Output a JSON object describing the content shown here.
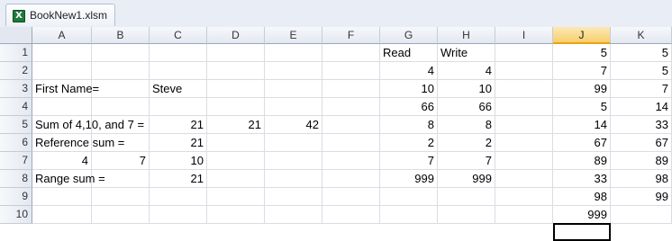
{
  "window": {
    "tab_title": "BookNew1.xlsm",
    "icon": "excel-file-icon"
  },
  "selected_column": "J",
  "columns": [
    "A",
    "B",
    "C",
    "D",
    "E",
    "F",
    "G",
    "H",
    "I",
    "J",
    "K"
  ],
  "rows": [
    "1",
    "2",
    "3",
    "4",
    "5",
    "6",
    "7",
    "8",
    "9",
    "10"
  ],
  "cells": [
    {
      "ref": "G1",
      "value": "Read",
      "type": "txt"
    },
    {
      "ref": "H1",
      "value": "Write",
      "type": "txt"
    },
    {
      "ref": "J1",
      "value": "5",
      "type": "num"
    },
    {
      "ref": "K1",
      "value": "5",
      "type": "num"
    },
    {
      "ref": "G2",
      "value": "4",
      "type": "num"
    },
    {
      "ref": "H2",
      "value": "4",
      "type": "num"
    },
    {
      "ref": "J2",
      "value": "7",
      "type": "num"
    },
    {
      "ref": "K2",
      "value": "5",
      "type": "num"
    },
    {
      "ref": "A3",
      "value": "First Name=",
      "type": "txt"
    },
    {
      "ref": "C3",
      "value": "Steve",
      "type": "txt"
    },
    {
      "ref": "G3",
      "value": "10",
      "type": "num"
    },
    {
      "ref": "H3",
      "value": "10",
      "type": "num"
    },
    {
      "ref": "J3",
      "value": "99",
      "type": "num"
    },
    {
      "ref": "K3",
      "value": "7",
      "type": "num"
    },
    {
      "ref": "G4",
      "value": "66",
      "type": "num"
    },
    {
      "ref": "H4",
      "value": "66",
      "type": "num"
    },
    {
      "ref": "J4",
      "value": "5",
      "type": "num"
    },
    {
      "ref": "K4",
      "value": "14",
      "type": "num"
    },
    {
      "ref": "A5",
      "value": "Sum of 4,10, and 7 =",
      "type": "txt"
    },
    {
      "ref": "C5",
      "value": "21",
      "type": "num"
    },
    {
      "ref": "D5",
      "value": "21",
      "type": "num"
    },
    {
      "ref": "E5",
      "value": "42",
      "type": "num"
    },
    {
      "ref": "G5",
      "value": "8",
      "type": "num"
    },
    {
      "ref": "H5",
      "value": "8",
      "type": "num"
    },
    {
      "ref": "J5",
      "value": "14",
      "type": "num"
    },
    {
      "ref": "K5",
      "value": "33",
      "type": "num"
    },
    {
      "ref": "A6",
      "value": "Reference sum =",
      "type": "txt"
    },
    {
      "ref": "C6",
      "value": "21",
      "type": "num"
    },
    {
      "ref": "G6",
      "value": "2",
      "type": "num"
    },
    {
      "ref": "H6",
      "value": "2",
      "type": "num"
    },
    {
      "ref": "J6",
      "value": "67",
      "type": "num"
    },
    {
      "ref": "K6",
      "value": "67",
      "type": "num"
    },
    {
      "ref": "A7",
      "value": "4",
      "type": "num"
    },
    {
      "ref": "B7",
      "value": "7",
      "type": "num"
    },
    {
      "ref": "C7",
      "value": "10",
      "type": "num"
    },
    {
      "ref": "G7",
      "value": "7",
      "type": "num"
    },
    {
      "ref": "H7",
      "value": "7",
      "type": "num"
    },
    {
      "ref": "J7",
      "value": "89",
      "type": "num"
    },
    {
      "ref": "K7",
      "value": "89",
      "type": "num"
    },
    {
      "ref": "A8",
      "value": "Range sum =",
      "type": "txt"
    },
    {
      "ref": "C8",
      "value": "21",
      "type": "num"
    },
    {
      "ref": "G8",
      "value": "999",
      "type": "num"
    },
    {
      "ref": "H8",
      "value": "999",
      "type": "num"
    },
    {
      "ref": "J8",
      "value": "33",
      "type": "num"
    },
    {
      "ref": "K8",
      "value": "98",
      "type": "num"
    },
    {
      "ref": "J9",
      "value": "98",
      "type": "num"
    },
    {
      "ref": "K9",
      "value": "99",
      "type": "num"
    },
    {
      "ref": "J10",
      "value": "999",
      "type": "num"
    }
  ]
}
